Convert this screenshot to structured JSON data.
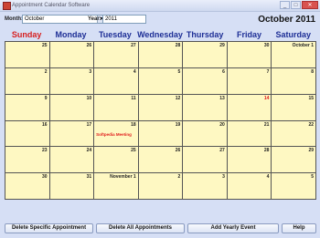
{
  "window": {
    "title": "Appointment Calendar Software",
    "controls": [
      "_",
      "□",
      "✕"
    ]
  },
  "toolbar": {
    "month_label": "Month:",
    "month_value": "October",
    "year_label": "Year:",
    "year_value": "2011",
    "current_title": "October 2011"
  },
  "weekdays": [
    "Sunday",
    "Monday",
    "Tuesday",
    "Wednesday",
    "Thursday",
    "Friday",
    "Saturday"
  ],
  "weeks": [
    [
      {
        "day": "25"
      },
      {
        "day": "26"
      },
      {
        "day": "27"
      },
      {
        "day": "28"
      },
      {
        "day": "29"
      },
      {
        "day": "30"
      },
      {
        "day": "October 1"
      }
    ],
    [
      {
        "day": "2"
      },
      {
        "day": "3"
      },
      {
        "day": "4"
      },
      {
        "day": "5"
      },
      {
        "day": "6"
      },
      {
        "day": "7"
      },
      {
        "day": "8"
      }
    ],
    [
      {
        "day": "9"
      },
      {
        "day": "10"
      },
      {
        "day": "11"
      },
      {
        "day": "12"
      },
      {
        "day": "13"
      },
      {
        "day": "14",
        "today": true
      },
      {
        "day": "15"
      }
    ],
    [
      {
        "day": "16"
      },
      {
        "day": "17"
      },
      {
        "day": "18",
        "event": "Softpedia Meeting"
      },
      {
        "day": "19"
      },
      {
        "day": "20"
      },
      {
        "day": "21"
      },
      {
        "day": "22"
      }
    ],
    [
      {
        "day": "23"
      },
      {
        "day": "24"
      },
      {
        "day": "25"
      },
      {
        "day": "26"
      },
      {
        "day": "27"
      },
      {
        "day": "28"
      },
      {
        "day": "29"
      }
    ],
    [
      {
        "day": "30"
      },
      {
        "day": "31"
      },
      {
        "day": "November 1"
      },
      {
        "day": "2"
      },
      {
        "day": "3"
      },
      {
        "day": "4"
      },
      {
        "day": "5"
      }
    ]
  ],
  "buttons": {
    "delete_specific": "Delete Specific Appointment",
    "delete_all": "Delete All Appointments",
    "add_yearly": "Add Yearly Event",
    "help": "Help"
  },
  "colors": {
    "cell_background": "#fef8c2",
    "weekday_text": "#1e2f96",
    "sunday_text": "#d71f1f",
    "highlight": "#e01b1b"
  }
}
